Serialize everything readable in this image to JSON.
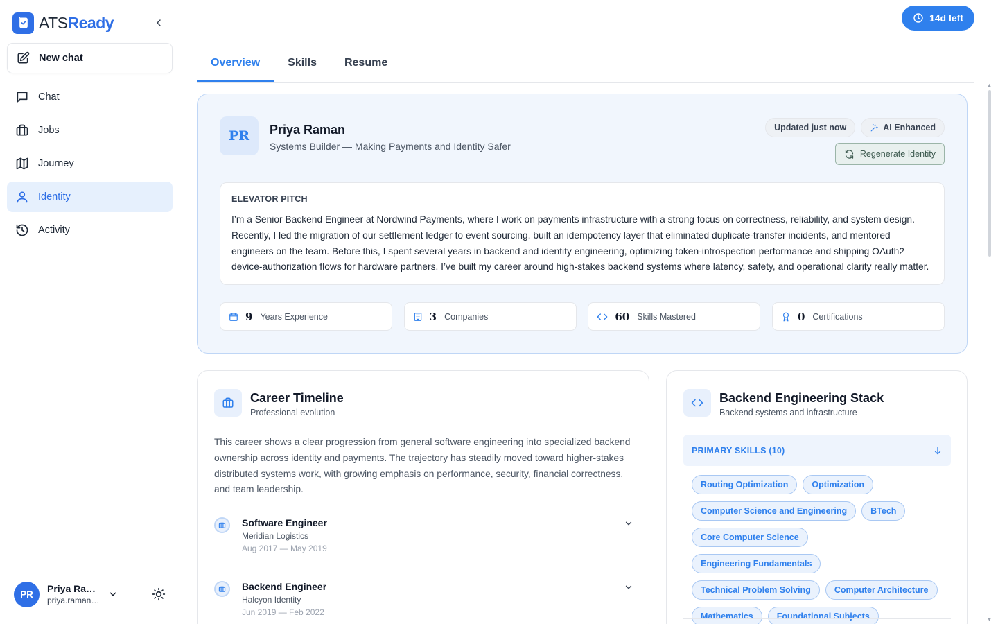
{
  "brand": {
    "ats": "ATS",
    "ready": "Ready"
  },
  "sidebar": {
    "new_chat": "New chat",
    "items": [
      {
        "label": "Chat",
        "icon": "chat-icon"
      },
      {
        "label": "Jobs",
        "icon": "briefcase-icon"
      },
      {
        "label": "Journey",
        "icon": "map-icon"
      },
      {
        "label": "Identity",
        "icon": "user-icon",
        "active": true
      },
      {
        "label": "Activity",
        "icon": "history-icon"
      }
    ],
    "user": {
      "initials": "PR",
      "name": "Priya Ram...",
      "email": "priya.raman@..."
    }
  },
  "header": {
    "trial": "14d left"
  },
  "tabs": [
    "Overview",
    "Skills",
    "Resume"
  ],
  "identity": {
    "initials": "PR",
    "name": "Priya Raman",
    "tagline": "Systems Builder — Making Payments and Identity Safer",
    "badge_updated": "Updated just now",
    "badge_ai": "AI Enhanced",
    "regenerate": "Regenerate Identity",
    "pitch_title": "ELEVATOR PITCH",
    "pitch_body": "I’m a Senior Backend Engineer at Nordwind Payments, where I work on payments infrastructure with a strong focus on correctness, reliability, and system design. Recently, I led the migration of our settlement ledger to event sourcing, built an idempotency layer that eliminated duplicate-transfer incidents, and mentored engineers on the team. Before this, I spent several years in backend and identity engineering, optimizing token-introspection performance and shipping OAuth2 device-authorization flows for hardware partners. I’ve built my career around high-stakes backend systems where latency, safety, and operational clarity really matter.",
    "stats": [
      {
        "num": "9",
        "label": "Years Experience",
        "icon": "calendar-icon"
      },
      {
        "num": "3",
        "label": "Companies",
        "icon": "building-icon"
      },
      {
        "num": "60",
        "label": "Skills Mastered",
        "icon": "code-icon"
      },
      {
        "num": "0",
        "label": "Certifications",
        "icon": "award-icon"
      }
    ]
  },
  "career": {
    "title": "Career Timeline",
    "subtitle": "Professional evolution",
    "summary": "This career shows a clear progression from general software engineering into specialized backend ownership across identity and payments. The trajectory has steadily moved toward higher-stakes distributed systems work, with growing emphasis on performance, security, financial correctness, and team leadership.",
    "items": [
      {
        "role": "Software Engineer",
        "company": "Meridian Logistics",
        "dates": "Aug 2017 — May 2019"
      },
      {
        "role": "Backend Engineer",
        "company": "Halcyon Identity",
        "dates": "Jun 2019 — Feb 2022"
      }
    ]
  },
  "stack": {
    "title": "Backend Engineering Stack",
    "subtitle": "Backend systems and infrastructure",
    "primary_label": "PRIMARY SKILLS (10)",
    "skills": [
      "Routing Optimization",
      "Optimization",
      "Computer Science and Engineering",
      "BTech",
      "Core Computer Science",
      "Engineering Fundamentals",
      "Technical Problem Solving",
      "Computer Architecture",
      "Mathematics",
      "Foundational Subjects"
    ]
  },
  "colors": {
    "accent": "#2f80ed",
    "brand": "#2f6fe6",
    "active_bg": "#e6f0fd",
    "card_bg": "#f1f6fd"
  }
}
